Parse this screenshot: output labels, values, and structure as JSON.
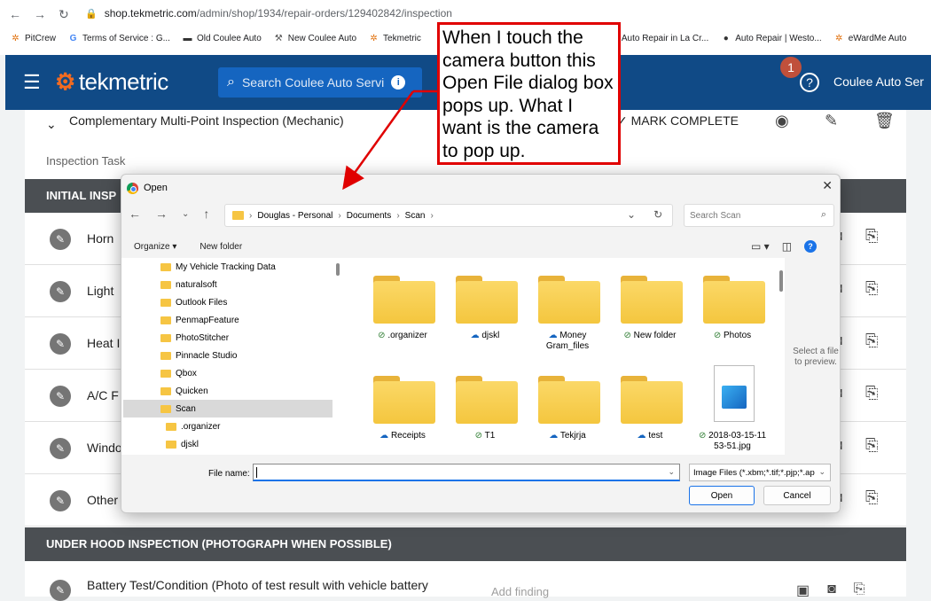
{
  "browser": {
    "url_host": "shop.tekmetric.com",
    "url_path": "/admin/shop/1934/repair-orders/129402842/inspection",
    "bookmarks": [
      {
        "label": "PitCrew",
        "icon": "gear-icon"
      },
      {
        "label": "Terms of Service : G...",
        "icon": "google-icon"
      },
      {
        "label": "Old Coulee Auto",
        "icon": "car-icon"
      },
      {
        "label": "New Coulee Auto",
        "icon": "wrench-icon"
      },
      {
        "label": "Tekmetric",
        "icon": "gear-icon"
      },
      {
        "label": "Auto Repair in La Cr...",
        "icon": "wrench-icon"
      },
      {
        "label": "Auto Repair | Westo...",
        "icon": "car-icon"
      },
      {
        "label": "eWardMe Auto",
        "icon": "gear-icon"
      }
    ]
  },
  "header": {
    "brand": "tekmetric",
    "search_placeholder": "Search Coulee Auto Servi",
    "notification_count": "1",
    "shop_name": "Coulee Auto Ser"
  },
  "inspection": {
    "title": "Complementary Multi-Point Inspection (Mechanic)",
    "mark_complete": "MARK COMPLETE",
    "task_label": "Inspection Task",
    "section_initial": "INITIAL INSP",
    "items": [
      "Horn",
      "Light",
      "Heat I",
      "A/C F",
      "Windo",
      "Other"
    ],
    "section_under_hood": "UNDER HOOD INSPECTION (PHOTOGRAPH WHEN POSSIBLE)",
    "bottom_item": "Battery Test/Condition (Photo of test result with vehicle battery",
    "add_finding": "Add finding"
  },
  "dialog": {
    "title": "Open",
    "breadcrumb": [
      "Douglas - Personal",
      "Documents",
      "Scan"
    ],
    "search_placeholder": "Search Scan",
    "organize": "Organize",
    "new_folder": "New folder",
    "nav_items": [
      {
        "label": "My Vehicle Tracking Data",
        "selected": false,
        "indent": 0
      },
      {
        "label": "naturalsoft",
        "selected": false,
        "indent": 0
      },
      {
        "label": "Outlook Files",
        "selected": false,
        "indent": 0
      },
      {
        "label": "PenmapFeature",
        "selected": false,
        "indent": 0
      },
      {
        "label": "PhotoStitcher",
        "selected": false,
        "indent": 0
      },
      {
        "label": "Pinnacle Studio",
        "selected": false,
        "indent": 0
      },
      {
        "label": "Qbox",
        "selected": false,
        "indent": 0
      },
      {
        "label": "Quicken",
        "selected": false,
        "indent": 0
      },
      {
        "label": "Scan",
        "selected": true,
        "indent": 0
      },
      {
        "label": ".organizer",
        "selected": false,
        "indent": 1
      },
      {
        "label": "djskl",
        "selected": false,
        "indent": 1
      }
    ],
    "files": [
      {
        "label": ".organizer",
        "status": "synced",
        "kind": "folder"
      },
      {
        "label": "djskl",
        "status": "cloud",
        "kind": "folder"
      },
      {
        "label": "Money Gram_files",
        "status": "cloud",
        "kind": "folder"
      },
      {
        "label": "New folder",
        "status": "synced",
        "kind": "folder"
      },
      {
        "label": "Photos",
        "status": "synced",
        "kind": "folder"
      },
      {
        "label": "Receipts",
        "status": "cloud",
        "kind": "folder"
      },
      {
        "label": "T1",
        "status": "synced",
        "kind": "folder"
      },
      {
        "label": "Tekjrja",
        "status": "cloud",
        "kind": "folder"
      },
      {
        "label": "test",
        "status": "cloud",
        "kind": "folder"
      },
      {
        "label": "2018-03-15-11 53-51.jpg",
        "status": "synced",
        "kind": "image"
      }
    ],
    "preview_text": "Select a file to preview.",
    "file_name_label": "File name:",
    "file_name_value": "",
    "file_type": "Image Files (*.xbm;*.tif;*.pjp;*.ap",
    "open_button": "Open",
    "cancel_button": "Cancel"
  },
  "annotation": {
    "text": "When I touch the camera button this Open File dialog box pops up.  What I want is the camera to pop up.",
    "color": "#e00000"
  }
}
